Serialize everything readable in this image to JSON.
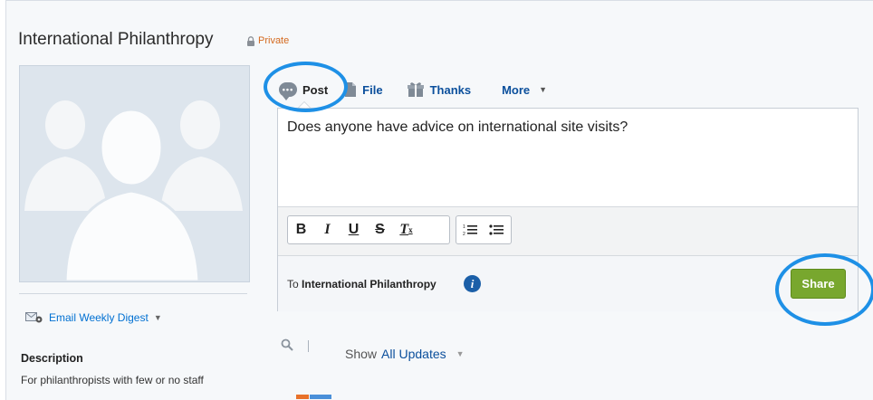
{
  "group": {
    "title": "International Philanthropy",
    "privacy": "Private"
  },
  "sidebar": {
    "digest_label": "Email Weekly Digest",
    "description_heading": "Description",
    "description_text": "For philanthropists with few or no staff"
  },
  "publisher": {
    "tabs": [
      {
        "label": "Post",
        "icon": "chat-bubble-icon"
      },
      {
        "label": "File",
        "icon": "file-icon"
      },
      {
        "label": "Thanks",
        "icon": "gift-icon"
      },
      {
        "label": "More",
        "icon": "chevron-down-icon"
      }
    ],
    "composer_text": "Does anyone have advice on international site visits?",
    "toolbar": [
      "B",
      "I",
      "U",
      "S",
      "Tx",
      "numbered-list",
      "bulleted-list"
    ],
    "to_prefix": "To",
    "to_target": "International Philanthropy",
    "share_label": "Share"
  },
  "feed_filter": {
    "show_label": "Show",
    "show_value": "All Updates"
  },
  "colors": {
    "accent_link": "#0b4f9c",
    "share_green": "#78a72e",
    "highlight_circle": "#1e90e6",
    "private_orange": "#d4691e"
  }
}
